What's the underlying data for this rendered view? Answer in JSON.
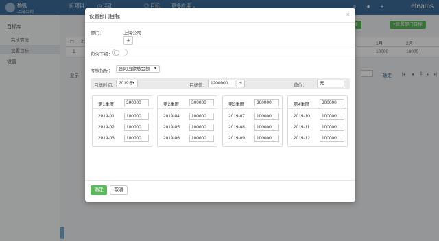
{
  "topbar": {
    "user_name": "杨帆",
    "user_org": "上海公司",
    "nav": [
      {
        "label": "项目",
        "icon": "grid-icon"
      },
      {
        "label": "活动",
        "icon": "clock-icon"
      },
      {
        "label": "目标",
        "icon": "target-icon"
      },
      {
        "label": "更多应用",
        "icon": "chevron-down-icon"
      }
    ],
    "brand": "eteams"
  },
  "sidebar": {
    "items": [
      {
        "label": "目标库",
        "type": "group"
      },
      {
        "label": "完成情况",
        "type": "sub"
      },
      {
        "label": "设置目标",
        "type": "sub",
        "active": true
      },
      {
        "label": "设置",
        "type": "group"
      }
    ]
  },
  "background": {
    "btn_personal": "+设置个人目标",
    "btn_dept": "+设置部门目标",
    "head_year": "20",
    "col_m1": "1月",
    "col_m2": "2月",
    "row_index": "1",
    "row_m1": "10000",
    "row_m2": "10000",
    "pager_text": "显示",
    "pager_ok": "确定",
    "pager_page": "1"
  },
  "modal": {
    "title": "设置部门目标",
    "dept_label": "部门：",
    "dept_value": "上海公司",
    "include_sub_label": "包含下级：",
    "kpi_label": "考核指标：",
    "kpi_value": "合同回款总金额",
    "time_label": "目标时间：",
    "time_value": "2019年",
    "target_label": "目标值：",
    "target_value": "1200000",
    "unit_label": "单位：",
    "unit_value": "元",
    "quarters": [
      {
        "label": "第1季度",
        "value": "300000",
        "months": [
          {
            "label": "2019-01",
            "value": "100000"
          },
          {
            "label": "2019-02",
            "value": "100000"
          },
          {
            "label": "2019-03",
            "value": "100000"
          }
        ]
      },
      {
        "label": "第2季度",
        "value": "300000",
        "months": [
          {
            "label": "2019-04",
            "value": "100000"
          },
          {
            "label": "2019-05",
            "value": "100000"
          },
          {
            "label": "2019-06",
            "value": "100000"
          }
        ]
      },
      {
        "label": "第3季度",
        "value": "300000",
        "months": [
          {
            "label": "2019-07",
            "value": "100000"
          },
          {
            "label": "2019-08",
            "value": "100000"
          },
          {
            "label": "2019-09",
            "value": "100000"
          }
        ]
      },
      {
        "label": "第4季度",
        "value": "300000",
        "months": [
          {
            "label": "2019-10",
            "value": "100000"
          },
          {
            "label": "2019-11",
            "value": "100000"
          },
          {
            "label": "2019-12",
            "value": "100000"
          }
        ]
      }
    ],
    "ok_label": "确定",
    "cancel_label": "取消"
  }
}
